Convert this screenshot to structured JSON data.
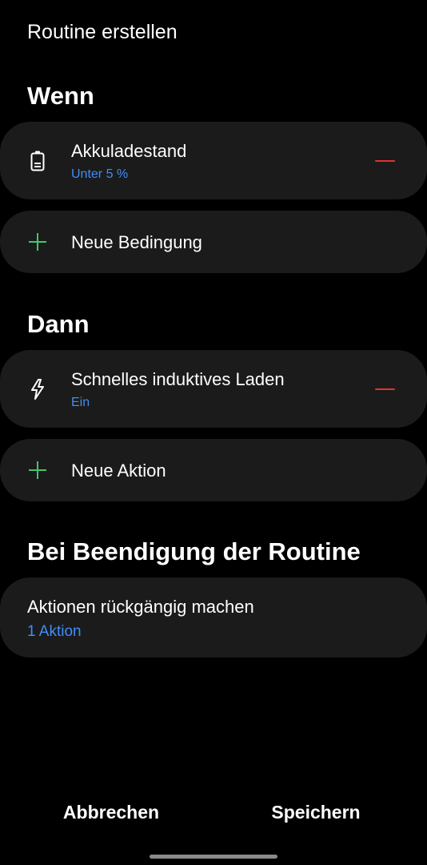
{
  "page": {
    "title": "Routine erstellen"
  },
  "when_section": {
    "title": "Wenn",
    "condition": {
      "icon": "battery-icon",
      "label": "Akkuladestand",
      "value": "Unter 5 %"
    },
    "add_label": "Neue Bedingung"
  },
  "then_section": {
    "title": "Dann",
    "action": {
      "icon": "flash-icon",
      "label": "Schnelles induktives Laden",
      "value": "Ein"
    },
    "add_label": "Neue Aktion"
  },
  "end_section": {
    "title": "Bei Beendigung der Routine",
    "item": {
      "label": "Aktionen rückgängig machen",
      "value": "1 Aktion"
    }
  },
  "footer": {
    "cancel_label": "Abbrechen",
    "save_label": "Speichern"
  },
  "colors": {
    "background": "#000000",
    "card": "#1b1b1b",
    "accent_blue": "#3e8ef7",
    "remove_red": "#e5322f",
    "add_green": "#3ec96a"
  }
}
